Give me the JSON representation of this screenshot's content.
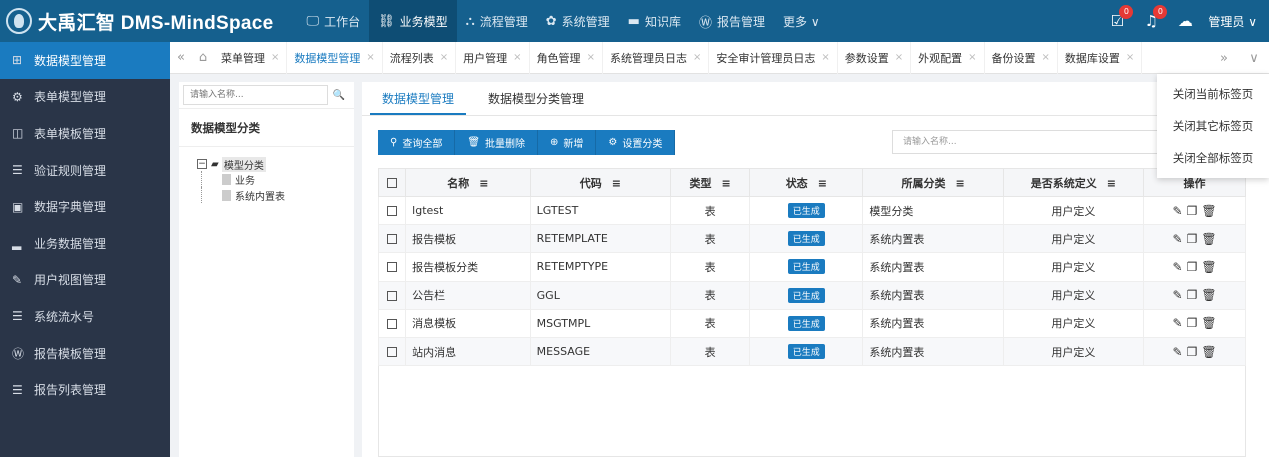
{
  "brand": "大禹汇智 DMS-MindSpace",
  "nav": [
    {
      "icon": "monitor-icon",
      "glyph": "🖵",
      "label": "工作台"
    },
    {
      "icon": "sitemap-icon",
      "glyph": "⛓",
      "label": "业务模型"
    },
    {
      "icon": "flow-icon",
      "glyph": "⛬",
      "label": "流程管理"
    },
    {
      "icon": "gear-icon",
      "glyph": "✿",
      "label": "系统管理"
    },
    {
      "icon": "folder-icon",
      "glyph": "▬",
      "label": "知识库"
    },
    {
      "icon": "report-icon",
      "glyph": "Ⓦ",
      "label": "报告管理"
    },
    {
      "icon": "",
      "glyph": "",
      "label": "更多 ∨"
    }
  ],
  "nav_active": 1,
  "top_right": {
    "msg_count": "0",
    "bell_count": "0",
    "user": "管理员 ∨"
  },
  "sidebar": [
    {
      "glyph": "⊞",
      "label": "数据模型管理"
    },
    {
      "glyph": "⚙",
      "label": "表单模型管理"
    },
    {
      "glyph": "◫",
      "label": "表单模板管理"
    },
    {
      "glyph": "☰",
      "label": "验证规则管理"
    },
    {
      "glyph": "▣",
      "label": "数据字典管理"
    },
    {
      "glyph": "▂",
      "label": "业务数据管理"
    },
    {
      "glyph": "✎",
      "label": "用户视图管理"
    },
    {
      "glyph": "☰",
      "label": "系统流水号"
    },
    {
      "glyph": "Ⓦ",
      "label": "报告模板管理"
    },
    {
      "glyph": "☰",
      "label": "报告列表管理"
    }
  ],
  "tabs": [
    "菜单管理",
    "数据模型管理",
    "流程列表",
    "用户管理",
    "角色管理",
    "系统管理员日志",
    "安全审计管理员日志",
    "参数设置",
    "外观配置",
    "备份设置",
    "数据库设置"
  ],
  "tab_active": 1,
  "tab_menu": [
    "关闭当前标签页",
    "关闭其它标签页",
    "关闭全部标签页"
  ],
  "left": {
    "search_placeholder": "请输入名称...",
    "title": "数据模型分类",
    "tree_root": "模型分类",
    "tree_children": [
      "业务",
      "系统内置表"
    ]
  },
  "main": {
    "tabs": [
      "数据模型管理",
      "数据模型分类管理"
    ],
    "toolbar": [
      "查询全部",
      "批量删除",
      "新增",
      "设置分类"
    ],
    "search_placeholder": "请输入名称..."
  },
  "table": {
    "headers": [
      "名称",
      "代码",
      "类型",
      "状态",
      "所属分类",
      "是否系统定义",
      "操作"
    ],
    "rows": [
      [
        "lgtest",
        "LGTEST",
        "表",
        "已生成",
        "模型分类",
        "用户定义"
      ],
      [
        "报告模板",
        "RETEMPLATE",
        "表",
        "已生成",
        "系统内置表",
        "用户定义"
      ],
      [
        "报告模板分类",
        "RETEMPTYPE",
        "表",
        "已生成",
        "系统内置表",
        "用户定义"
      ],
      [
        "公告栏",
        "GGL",
        "表",
        "已生成",
        "系统内置表",
        "用户定义"
      ],
      [
        "消息模板",
        "MSGTMPL",
        "表",
        "已生成",
        "系统内置表",
        "用户定义"
      ],
      [
        "站内消息",
        "MESSAGE",
        "表",
        "已生成",
        "系统内置表",
        "用户定义"
      ]
    ]
  },
  "colors": {
    "topbar": "#15608e",
    "accent": "#1a7bc0",
    "sidebar": "#2a3548"
  }
}
